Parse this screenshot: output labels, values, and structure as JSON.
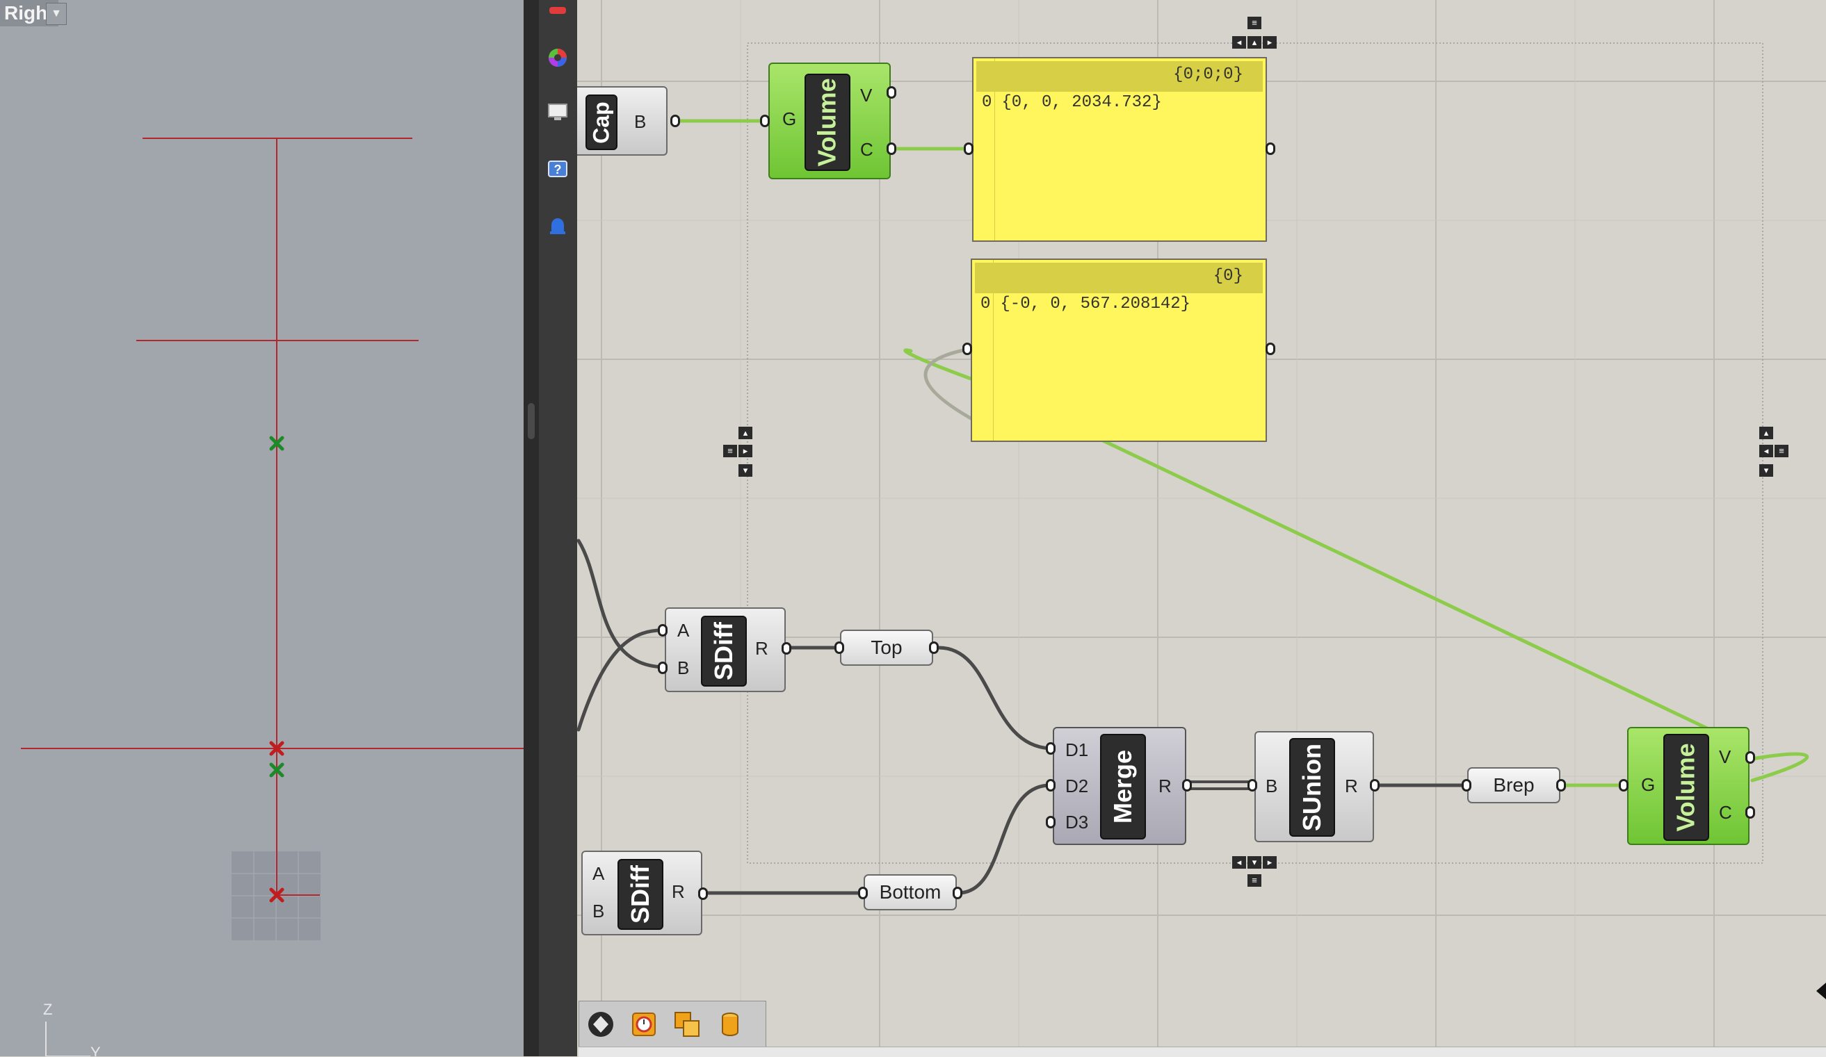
{
  "viewport": {
    "name": "Right",
    "axis_z": "Z",
    "axis_y": "Y"
  },
  "toolbar": {
    "icons": [
      "color-wheel-icon",
      "monitor-icon",
      "help-icon",
      "bell-icon"
    ]
  },
  "components": {
    "cap": {
      "name": "Cap",
      "out": "B"
    },
    "volume_top": {
      "name": "Volume",
      "in": "G",
      "out_v": "V",
      "out_c": "C"
    },
    "sdiff1": {
      "name": "SDiff",
      "in_a": "A",
      "in_b": "B",
      "out": "R"
    },
    "sdiff2": {
      "name": "SDiff",
      "in_a": "A",
      "in_b": "B",
      "out": "R"
    },
    "merge": {
      "name": "Merge",
      "in_d1": "D1",
      "in_d2": "D2",
      "in_d3": "D3",
      "out": "R"
    },
    "sunion": {
      "name": "SUnion",
      "in": "B",
      "out": "R"
    },
    "volume_bottom": {
      "name": "Volume",
      "in": "G",
      "out_v": "V",
      "out_c": "C"
    }
  },
  "params": {
    "top": "Top",
    "bottom": "Bottom",
    "brep": "Brep"
  },
  "panels": {
    "panel1": {
      "path": "{0;0;0}",
      "index": "0",
      "value": "{0, 0, 2034.732}"
    },
    "panel2": {
      "path": "{0}",
      "index": "0",
      "value": "{-0, 0, 567.208142}"
    }
  },
  "bottom_toolbar": {
    "icons": [
      "preview-icon",
      "timer-icon",
      "copy-icon",
      "cylinder-icon"
    ]
  },
  "colors": {
    "wire_green": "#8ccc4a",
    "wire_dark": "#4a4a4a",
    "panel_yellow": "#fff65e",
    "component_green": "#7bd03c"
  }
}
